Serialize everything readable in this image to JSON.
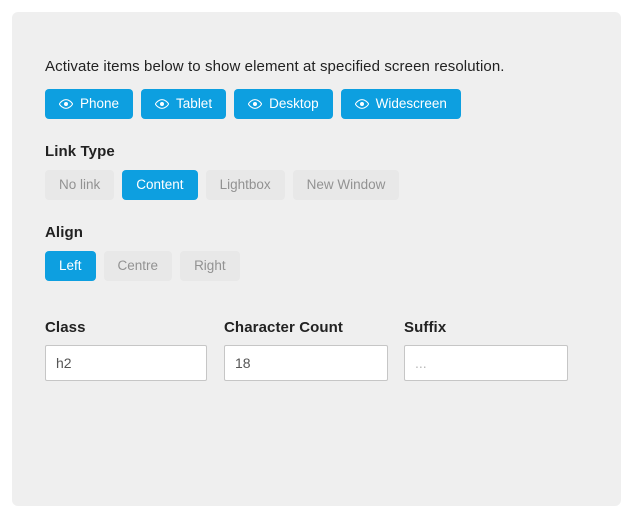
{
  "panel": {
    "background_color": "#efefef",
    "accent_color": "#0d9fe0",
    "inactive_color": "#e8e8e8"
  },
  "intro": {
    "text": "Activate items below to show element at specified screen resolution."
  },
  "resolution_buttons": {
    "icon": "eye-icon",
    "items": [
      {
        "label": "Phone",
        "active": true
      },
      {
        "label": "Tablet",
        "active": true
      },
      {
        "label": "Desktop",
        "active": true
      },
      {
        "label": "Widescreen",
        "active": true
      }
    ]
  },
  "link_type": {
    "label": "Link Type",
    "options": [
      {
        "label": "No link",
        "selected": false
      },
      {
        "label": "Content",
        "selected": true
      },
      {
        "label": "Lightbox",
        "selected": false
      },
      {
        "label": "New Window",
        "selected": false
      }
    ],
    "selected": "Content"
  },
  "align": {
    "label": "Align",
    "options": [
      {
        "label": "Left",
        "selected": true
      },
      {
        "label": "Centre",
        "selected": false
      },
      {
        "label": "Right",
        "selected": false
      }
    ],
    "selected": "Left"
  },
  "fields": {
    "class": {
      "label": "Class",
      "value": "h2",
      "placeholder": ""
    },
    "character_count": {
      "label": "Character Count",
      "value": "18",
      "placeholder": ""
    },
    "suffix": {
      "label": "Suffix",
      "value": "",
      "placeholder": "..."
    }
  }
}
